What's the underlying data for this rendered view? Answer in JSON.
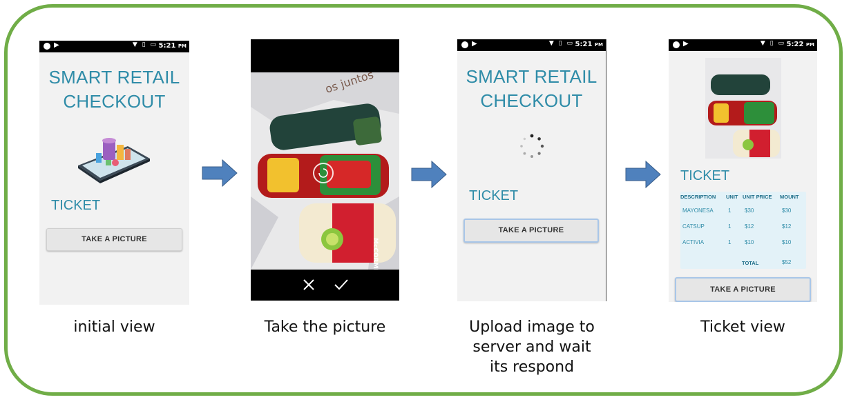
{
  "screens": {
    "initial": {
      "status_time": "5:21",
      "status_ampm": "PM",
      "title_line1": "SMART RETAIL",
      "title_line2": "CHECKOUT",
      "ticket_label": "TICKET",
      "button_label": "TAKE A PICTURE",
      "caption": "initial view"
    },
    "camera": {
      "caption": "Take the picture"
    },
    "upload": {
      "status_time": "5:21",
      "status_ampm": "PM",
      "title_line1": "SMART RETAIL",
      "title_line2": "CHECKOUT",
      "ticket_label": "TICKET",
      "button_label": "TAKE A PICTURE",
      "caption_line1": "Upload image to",
      "caption_line2": "server and wait",
      "caption_line3": "its respond"
    },
    "ticket": {
      "status_time": "5:22",
      "status_ampm": "PM",
      "ticket_label": "TICKET",
      "button_label": "TAKE A PICTURE",
      "caption": "Ticket view",
      "table": {
        "headers": [
          "DESCRIPTION",
          "UNIT",
          "UNIT PRICE",
          "MOUNT"
        ],
        "rows": [
          [
            "MAYONESA",
            "1",
            "$30",
            "$30"
          ],
          [
            "CATSUP",
            "1",
            "$12",
            "$12"
          ],
          [
            "ACTIVIA",
            "1",
            "$10",
            "$10"
          ]
        ],
        "total_label": "TOTAL",
        "total_value": "$52"
      }
    }
  },
  "colors": {
    "frame": "#70ad47",
    "accent": "#2f8ca8",
    "arrow": "#4f81bd"
  },
  "icons": [
    "play-icon",
    "wifi-icon",
    "battery-icon",
    "close-icon",
    "check-icon",
    "rotate-icon"
  ]
}
